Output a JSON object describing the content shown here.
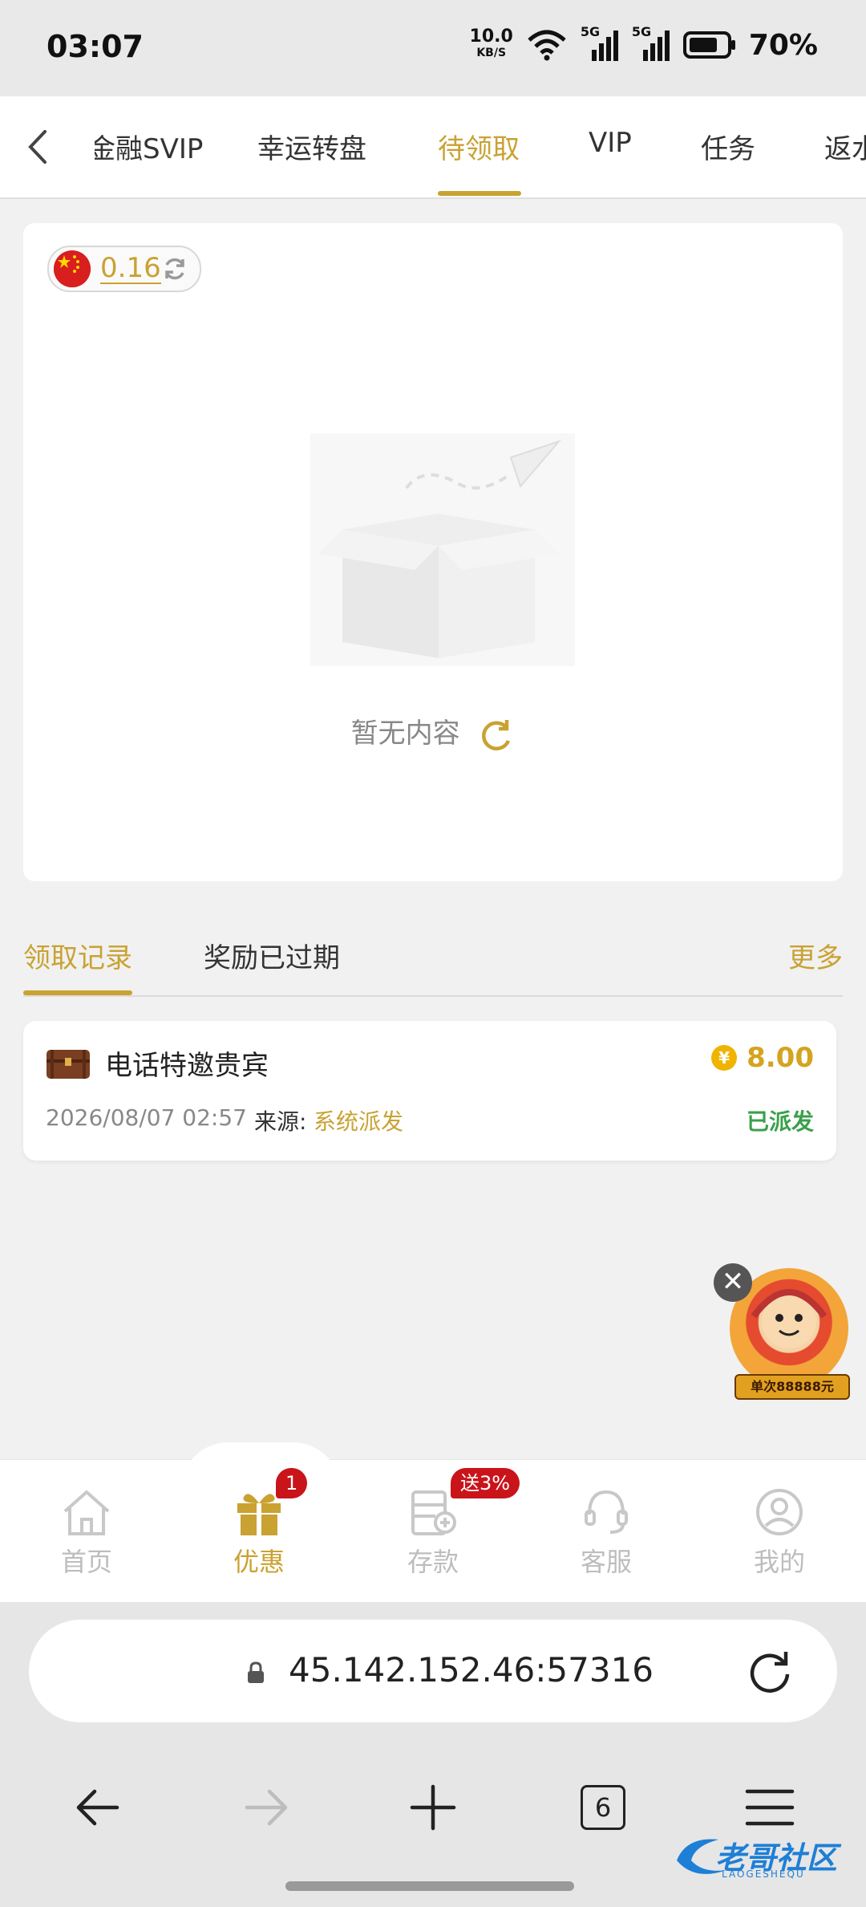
{
  "status_bar": {
    "time": "03:07",
    "net_speed": "10.0",
    "net_unit": "KB/S",
    "signal_1": "5G",
    "signal_2": "5G",
    "battery": "70%"
  },
  "top_tabs": {
    "items": [
      "金融SVIP",
      "幸运转盘",
      "待领取",
      "VIP",
      "任务",
      "返水"
    ],
    "active": "待领取"
  },
  "wallet": {
    "currency_flag": "china-flag-icon",
    "balance": "0.16"
  },
  "empty_state": {
    "text": "暂无内容"
  },
  "record_tabs": {
    "tab1": "领取记录",
    "tab2": "奖励已过期",
    "more": "更多"
  },
  "records": [
    {
      "title": "电话特邀贵宾",
      "amount": "8.00",
      "coin_symbol": "¥",
      "datetime": "2026/08/07 02:57",
      "source_label": "来源:",
      "source": "系统派发",
      "status": "已派发"
    }
  ],
  "promo": {
    "label": "单次88888元",
    "close": "✕"
  },
  "bottom_nav": {
    "items": [
      {
        "label": "首页",
        "icon": "home-icon"
      },
      {
        "label": "优惠",
        "icon": "gift-icon",
        "badge": "1"
      },
      {
        "label": "存款",
        "icon": "deposit-icon",
        "badge": "送3%"
      },
      {
        "label": "客服",
        "icon": "headset-icon"
      },
      {
        "label": "我的",
        "icon": "user-icon"
      }
    ],
    "active": "优惠"
  },
  "browser": {
    "url": "45.142.152.46:57316",
    "tab_count": "6"
  },
  "watermark": {
    "text": "老哥社区",
    "subtext": "LAOGESHEQU"
  },
  "colors": {
    "accent": "#c9a232",
    "success": "#3aa04a",
    "badge": "#c9141a"
  }
}
